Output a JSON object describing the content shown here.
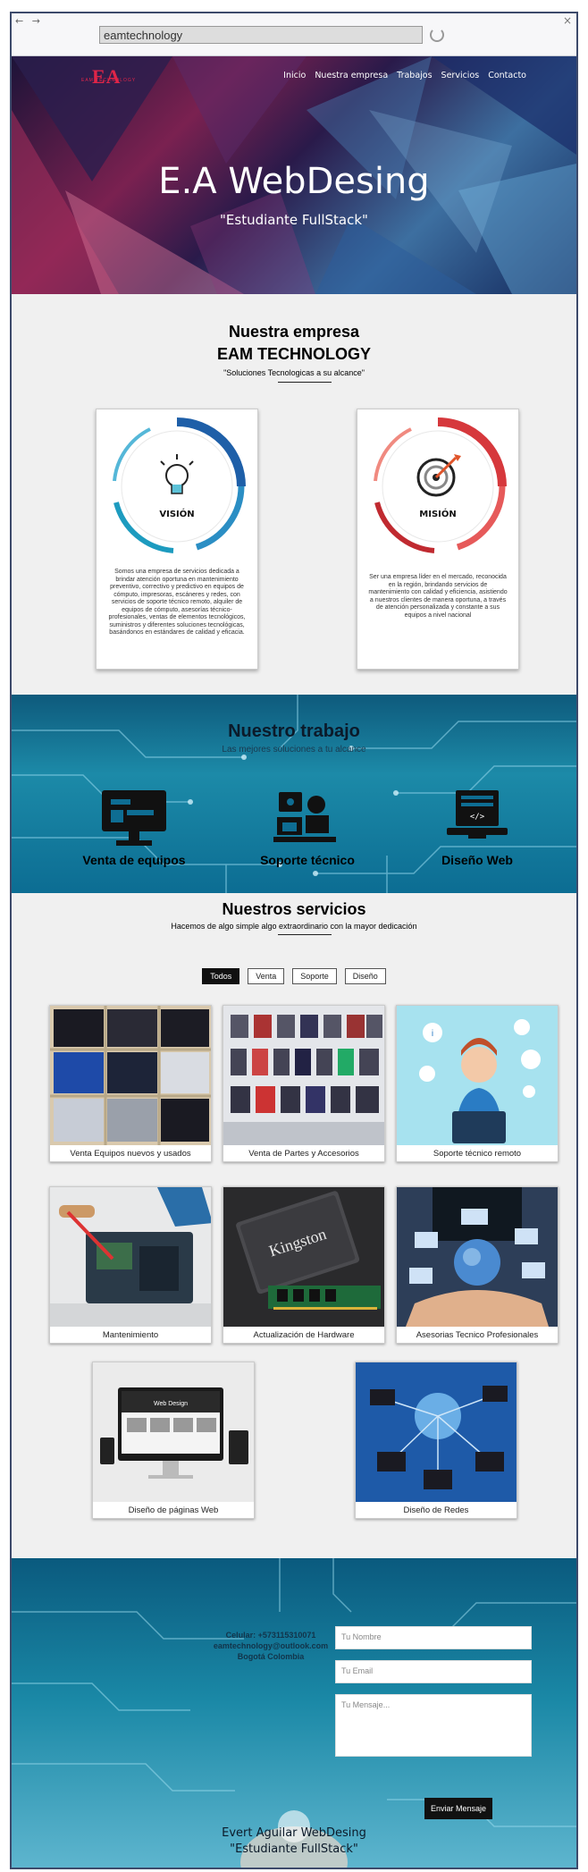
{
  "browser": {
    "url": "eamtechnology",
    "nav_icons": "back-forward",
    "close": "×"
  },
  "header": {
    "logo_big": "EA",
    "logo_small": "EAM TECHNOLOGY",
    "nav": [
      "Inicio",
      "Nuestra empresa",
      "Trabajos",
      "Servicios",
      "Contacto"
    ]
  },
  "hero": {
    "title": "E.A WebDesing",
    "subtitle": "\"Estudiante FullStack\""
  },
  "empresa": {
    "title1": "Nuestra empresa",
    "title2": "EAM TECHNOLOGY",
    "tagline": "\"Soluciones Tecnologicas a su alcance\"",
    "cards": [
      {
        "label": "VISIÓN",
        "icon": "lightbulb-icon",
        "text": "Somos una empresa de servicios dedicada a brindar atención oportuna en mantenimiento preventivo, correctivo y predictivo en equipos de cómputo, impresoras, escáneres y redes, con servicios de soporte técnico remoto, alquiler de equipos de cómputo, asesorías técnico-profesionales, ventas de elementos tecnológicos, suministros y diferentes soluciones tecnológicas, basándonos en estándares de calidad y eficacia."
      },
      {
        "label": "MISIÓN",
        "icon": "target-icon",
        "text": "Ser una empresa líder en el mercado, reconocida en la región, brindando servicios de mantenimiento con calidad y eficiencia, asistiendo a nuestros clientes de manera oportuna, a través de atención personalizada y constante a sus equipos a nivel nacional"
      }
    ]
  },
  "trabajo": {
    "title": "Nuestro trabajo",
    "subtitle": "Las mejores soluciones a tu alcance",
    "items": [
      {
        "label": "Venta de equipos",
        "icon": "monitor-icon"
      },
      {
        "label": "Soporte técnico",
        "icon": "support-icon"
      },
      {
        "label": "Diseño Web",
        "icon": "code-laptop-icon"
      }
    ]
  },
  "servicios": {
    "title": "Nuestros servicios",
    "subtitle": "Hacemos de algo simple algo extraordinario con la mayor dedicación",
    "filters": [
      "Todos",
      "Venta",
      "Soporte",
      "Diseño"
    ],
    "active_filter": "Todos",
    "items": [
      "Venta Equipos nuevos y usados",
      "Venta de Partes y Accesorios",
      "Soporte técnico remoto",
      "Mantenimiento",
      "Actualización de Hardware",
      "Asesorias Tecnico Profesionales",
      "Diseño de páginas Web",
      "Diseño de Redes"
    ],
    "ssd_brand": "Kingston"
  },
  "contacto": {
    "cellular": "Celular: +573115310071",
    "email": "eamtechnology@outlook.com",
    "city": "Bogotá Colombia",
    "name_placeholder": "Tu Nombre",
    "email_placeholder": "Tu Email",
    "message_placeholder": "Tu Mensaje...",
    "send_label": "Enviar Mensaje",
    "footer_name": "Evert Aguilar WebDesing",
    "footer_sub": "\"Estudiante FullStack\""
  },
  "colors": {
    "accent_red": "#e02548",
    "vision_blue": "#1e5fa8",
    "mision_red": "#d6383c"
  }
}
